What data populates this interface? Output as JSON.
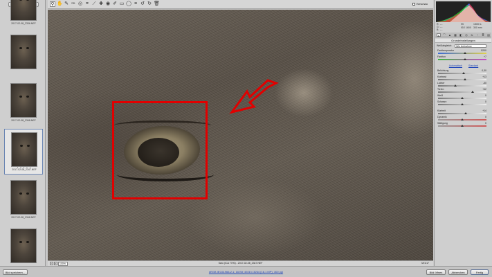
{
  "filmstrip": {
    "select_all_label": "Alle auswählen",
    "thumbs": [
      {
        "caption": "2017-02-08_2336.NEF",
        "rating": ""
      },
      {
        "caption": "",
        "rating": ""
      },
      {
        "caption": "2017-02-08_2348.NEF",
        "rating": ""
      },
      {
        "caption": "2017-02-08_2347.NEF",
        "rating": "• • • • •"
      },
      {
        "caption": "2017-02-08_2348.NEF",
        "rating": ""
      },
      {
        "caption": "",
        "rating": ""
      }
    ]
  },
  "toolbar": {
    "tools": [
      {
        "name": "zoom-tool",
        "glyph": "⚲"
      },
      {
        "name": "hand-tool",
        "glyph": "✋"
      },
      {
        "name": "white-balance-tool",
        "glyph": "✎"
      },
      {
        "name": "color-sampler-tool",
        "glyph": "✑"
      },
      {
        "name": "targeted-adjustment-tool",
        "glyph": "◎"
      },
      {
        "name": "crop-tool",
        "glyph": "⌗"
      },
      {
        "name": "straighten-tool",
        "glyph": "⟋"
      },
      {
        "name": "spot-removal-tool",
        "glyph": "✚"
      },
      {
        "name": "red-eye-tool",
        "glyph": "◉"
      },
      {
        "name": "adjustment-brush-tool",
        "glyph": "✐"
      },
      {
        "name": "graduated-filter-tool",
        "glyph": "▭"
      },
      {
        "name": "radial-filter-tool",
        "glyph": "◯"
      },
      {
        "name": "preferences-tool",
        "glyph": "≡"
      },
      {
        "name": "rotate-left-tool",
        "glyph": "↺"
      },
      {
        "name": "rotate-right-tool",
        "glyph": "↻"
      },
      {
        "name": "trash-tool",
        "glyph": "🗑"
      }
    ],
    "preview_label": "Vorschau"
  },
  "statusbar": {
    "zoom_value": "100%",
    "filename": "Saro (ICA 7790) - 2017-02-08_2347.NEF",
    "nav": "M/1/17"
  },
  "histogram_info": {
    "r_label": "R:",
    "g_label": "G:",
    "b_label": "B:",
    "r_val": "---",
    "g_val": "---",
    "b_val": "---",
    "aperture": "f/5",
    "shutter": "1/800 s",
    "iso": "ISO 1600",
    "focal": "300 mm"
  },
  "panel": {
    "section_title": "Grundeinstellungen",
    "wb_label": "Weißabgleich:",
    "wb_value": "Wie Aufnahme",
    "links": {
      "auto": "Automatisch",
      "default": "Standard"
    },
    "sliders": [
      {
        "label": "Farbtemperatur",
        "value": "5200",
        "level": 0.55,
        "track": "temp"
      },
      {
        "label": "Farbton",
        "value": "+7",
        "level": 0.56,
        "track": "tint"
      },
      {
        "label": "Belichtung",
        "value": "0,30",
        "level": 0.53,
        "track": "gray"
      },
      {
        "label": "Kontrast",
        "value": "+13",
        "level": 0.56,
        "track": "gray"
      },
      {
        "label": "Lichter",
        "value": "-30",
        "level": 0.35,
        "track": "gray"
      },
      {
        "label": "Tiefen",
        "value": "+42",
        "level": 0.71,
        "track": "gray"
      },
      {
        "label": "Weiß",
        "value": "0",
        "level": 0.5,
        "track": "gray"
      },
      {
        "label": "Schwarz",
        "value": "0",
        "level": 0.5,
        "track": "gray"
      },
      {
        "label": "Klarheit",
        "value": "+14",
        "level": 0.57,
        "track": "gray"
      },
      {
        "label": "Dynamik",
        "value": "0",
        "level": 0.5,
        "track": "vib"
      },
      {
        "label": "Sättigung",
        "value": "0",
        "level": 0.5,
        "track": "sat"
      }
    ]
  },
  "bottombar": {
    "save_label": "Bild speichern...",
    "workflow_link": "sRGB IEC61966-2.1; 16 Bit; 4928 x 3264 (16,1 MP); 300 ppi",
    "open_label": "Bild öffnen",
    "cancel_label": "Abbrechen",
    "done_label": "Fertig"
  },
  "colors": {
    "highlight": "#e10000",
    "link": "#1e44b8",
    "selected_thumb_border": "#6b86b3"
  }
}
